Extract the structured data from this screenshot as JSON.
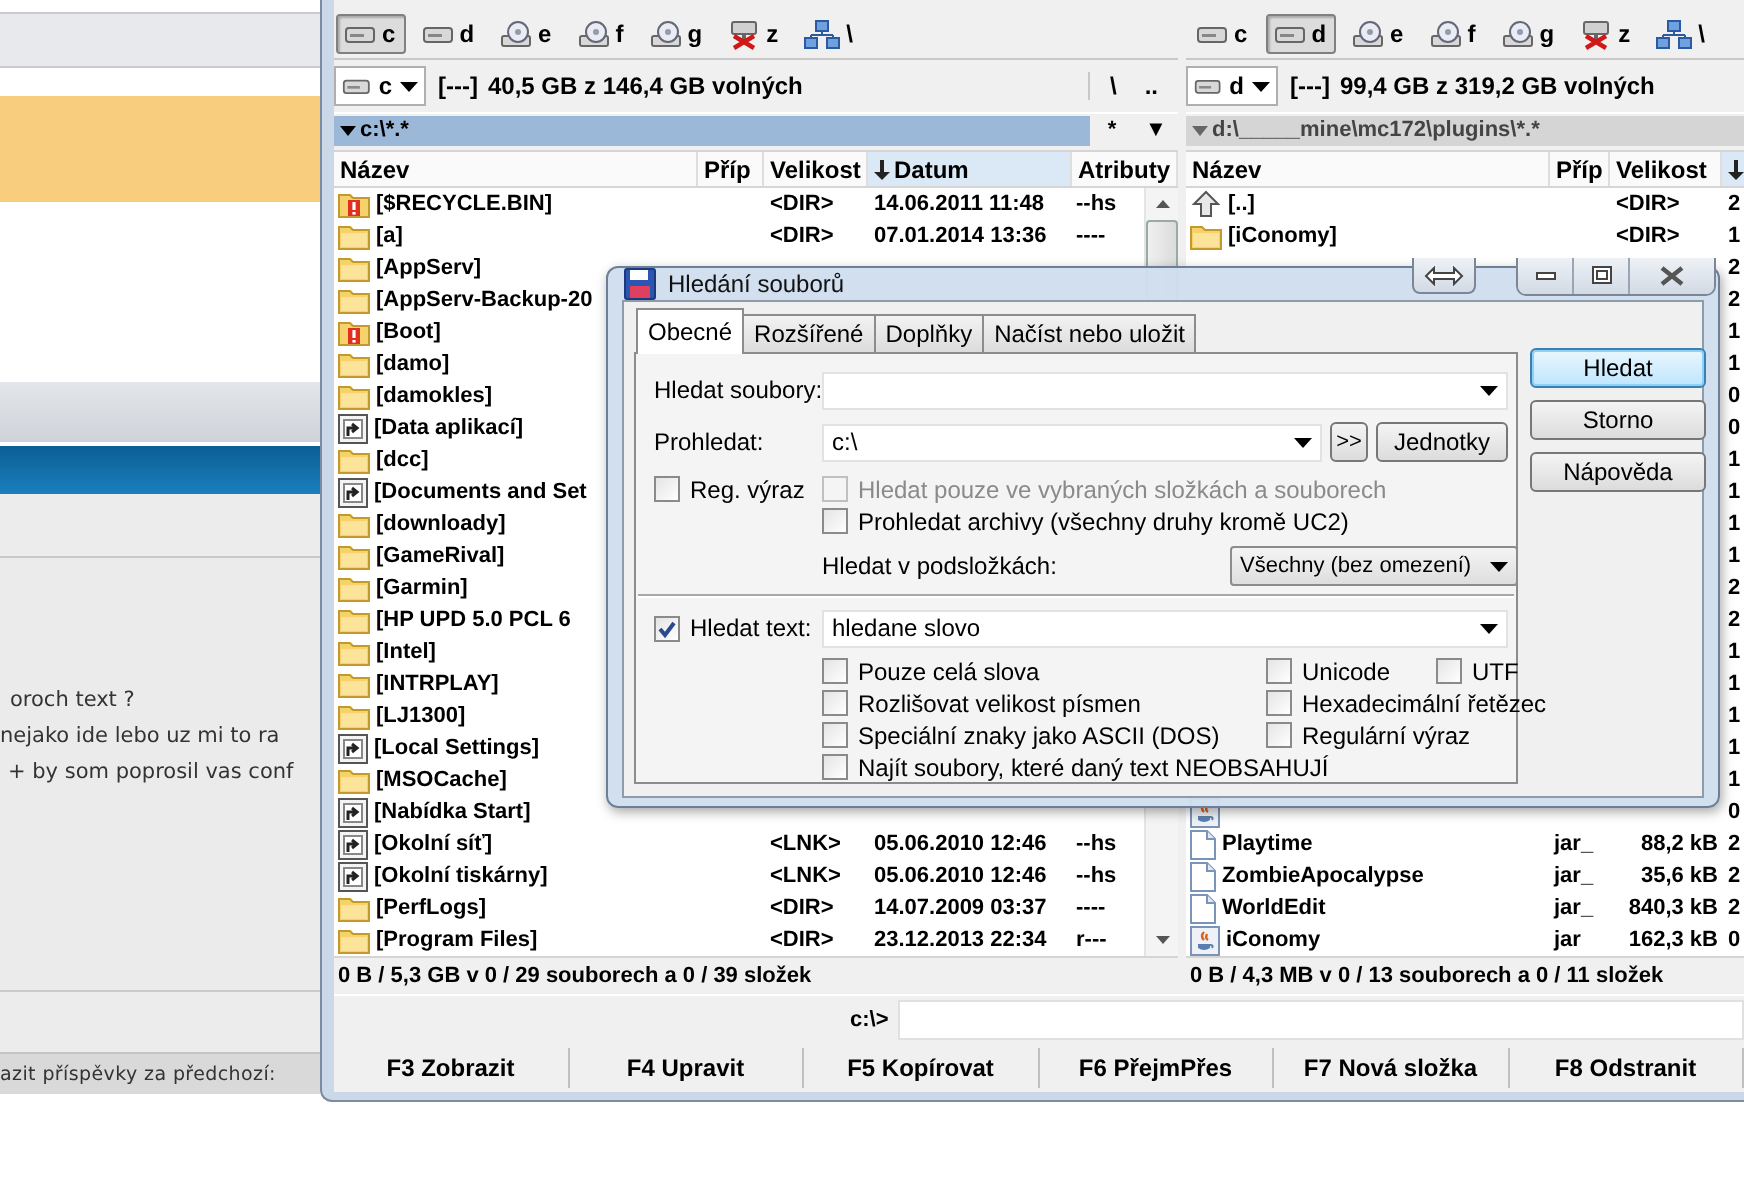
{
  "background_page": {
    "text_lines": [
      "oroch text ?",
      "nejako ide lebo uz mi to ra",
      "+ by som poprosil vas conf"
    ],
    "footer": "azit příspěvky za předchozí:"
  },
  "panels": [
    {
      "active": true,
      "drive_buttons": [
        {
          "label": "c",
          "kind": "hdd",
          "selected": true
        },
        {
          "label": "d",
          "kind": "hdd",
          "selected": false
        },
        {
          "label": "e",
          "kind": "disc",
          "selected": false
        },
        {
          "label": "f",
          "kind": "disc",
          "selected": false
        },
        {
          "label": "g",
          "kind": "disc",
          "selected": false
        },
        {
          "label": "z",
          "kind": "net-off",
          "selected": false
        },
        {
          "label": "\\",
          "kind": "network",
          "selected": false
        }
      ],
      "drive_select": "c",
      "volume_label": "[---]",
      "free_space": "40,5 GB z 146,4 GB volných",
      "nav_buttons": [
        "\\",
        ".."
      ],
      "path": "c:\\*.*",
      "path_buttons": [
        "*",
        "▼"
      ],
      "columns": [
        {
          "label": "Název",
          "sorted": false
        },
        {
          "label": "Příp",
          "sorted": false
        },
        {
          "label": "Velikost",
          "sorted": false
        },
        {
          "label": "Datum",
          "sorted": true
        },
        {
          "label": "Atributy",
          "sorted": false
        }
      ],
      "rows": [
        {
          "kind": "folder-warning",
          "name": "[$RECYCLE.BIN]",
          "size": "<DIR>",
          "date": "14.06.2011 11:48",
          "attr": "--hs"
        },
        {
          "kind": "folder",
          "name": "[a]",
          "size": "<DIR>",
          "date": "07.01.2014 13:36",
          "attr": "----"
        },
        {
          "kind": "folder",
          "name": "[AppServ]"
        },
        {
          "kind": "folder",
          "name": "[AppServ-Backup-20"
        },
        {
          "kind": "folder-warning",
          "name": "[Boot]"
        },
        {
          "kind": "folder",
          "name": "[damo]"
        },
        {
          "kind": "folder",
          "name": "[damokles]"
        },
        {
          "kind": "link",
          "name": "[Data aplikací]"
        },
        {
          "kind": "folder",
          "name": "[dcc]"
        },
        {
          "kind": "link",
          "name": "[Documents and Set"
        },
        {
          "kind": "folder",
          "name": "[downloady]"
        },
        {
          "kind": "folder",
          "name": "[GameRival]"
        },
        {
          "kind": "folder",
          "name": "[Garmin]"
        },
        {
          "kind": "folder",
          "name": "[HP UPD 5.0 PCL 6"
        },
        {
          "kind": "folder",
          "name": "[Intel]"
        },
        {
          "kind": "folder",
          "name": "[INTRPLAY]"
        },
        {
          "kind": "folder",
          "name": "[LJ1300]"
        },
        {
          "kind": "link",
          "name": "[Local Settings]"
        },
        {
          "kind": "folder",
          "name": "[MSOCache]"
        },
        {
          "kind": "link",
          "name": "[Nabídka Start]"
        },
        {
          "kind": "link",
          "name": "[Okolní síť]",
          "size": "<LNK>",
          "date": "05.06.2010 12:46",
          "attr": "--hs"
        },
        {
          "kind": "link",
          "name": "[Okolní tiskárny]",
          "size": "<LNK>",
          "date": "05.06.2010 12:46",
          "attr": "--hs"
        },
        {
          "kind": "folder",
          "name": "[PerfLogs]",
          "size": "<DIR>",
          "date": "14.07.2009 03:37",
          "attr": "----"
        },
        {
          "kind": "folder",
          "name": "[Program Files]",
          "size": "<DIR>",
          "date": "23.12.2013 22:34",
          "attr": "r---"
        }
      ],
      "status": "0 B / 5,3 GB v 0 / 29 souborech a 0 / 39 složek"
    },
    {
      "active": false,
      "drive_buttons": [
        {
          "label": "c",
          "kind": "hdd",
          "selected": false
        },
        {
          "label": "d",
          "kind": "hdd",
          "selected": true
        },
        {
          "label": "e",
          "kind": "disc",
          "selected": false
        },
        {
          "label": "f",
          "kind": "disc",
          "selected": false
        },
        {
          "label": "g",
          "kind": "disc",
          "selected": false
        },
        {
          "label": "z",
          "kind": "net-off",
          "selected": false
        },
        {
          "label": "\\",
          "kind": "network",
          "selected": false
        }
      ],
      "drive_select": "d",
      "volume_label": "[---]",
      "free_space": "99,4 GB z 319,2 GB volných",
      "path": "d:\\_____mine\\mc172\\plugins\\*.*",
      "columns": [
        {
          "label": "Název",
          "sorted": false
        },
        {
          "label": "Příp",
          "sorted": false
        },
        {
          "label": "Velikost",
          "sorted": false
        },
        {
          "sorted": true
        }
      ],
      "rows": [
        {
          "kind": "up",
          "name": "[..]",
          "size": "<DIR>",
          "date": "2"
        },
        {
          "kind": "folder",
          "name": "[iConomy]",
          "size": "<DIR>",
          "date": "1"
        },
        {
          "date": "2"
        },
        {
          "date": "2"
        },
        {
          "date": "1"
        },
        {
          "date": "1"
        },
        {
          "date": "0"
        },
        {
          "date": "0"
        },
        {
          "date": "1"
        },
        {
          "date": "1"
        },
        {
          "date": "1"
        },
        {
          "date": "1"
        },
        {
          "date": "2"
        },
        {
          "date": "2"
        },
        {
          "date": "1"
        },
        {
          "date": "1"
        },
        {
          "date": "1"
        },
        {
          "date": "1"
        },
        {
          "date": "1"
        },
        {
          "kind": "jar",
          "date": "0"
        },
        {
          "kind": "file",
          "name": "Playtime",
          "ext": "jar_",
          "size": "88,2 kB",
          "date": "2"
        },
        {
          "kind": "file",
          "name": "ZombieApocalypse",
          "ext": "jar_",
          "size": "35,6 kB",
          "date": "2"
        },
        {
          "kind": "file",
          "name": "WorldEdit",
          "ext": "jar_",
          "size": "840,3 kB",
          "date": "2"
        },
        {
          "kind": "jar",
          "name": "iConomy",
          "ext": "jar",
          "size": "162,3 kB",
          "date": "0"
        }
      ],
      "status": "0 B / 4,3 MB v 0 / 13 souborech a 0 / 11 složek"
    }
  ],
  "command_line": {
    "prompt": "c:\\>"
  },
  "function_keys": [
    "F3 Zobrazit",
    "F4 Upravit",
    "F5 Kopírovat",
    "F6 PřejmPřes",
    "F7 Nová složka",
    "F8 Odstranit"
  ],
  "dialog": {
    "title": "Hledání souborů",
    "tabs": [
      {
        "label": "Obecné",
        "selected": true
      },
      {
        "label": "Rozšířené",
        "selected": false
      },
      {
        "label": "Doplňky",
        "selected": false
      },
      {
        "label": "Načíst nebo uložit",
        "selected": false
      }
    ],
    "search_files": {
      "label": "Hledat soubory:"
    },
    "search_in": {
      "label": "Prohledat:",
      "value": "c:\\",
      "buttons": [
        ">>",
        "Jednotky"
      ]
    },
    "regex": {
      "label": "Reg. výraz",
      "checked": false,
      "disabled": false
    },
    "only_selected": {
      "label": "Hledat pouze ve vybraných složkách a souborech",
      "checked": false,
      "disabled": true
    },
    "archives": {
      "label": "Prohledat archivy (všechny druhy kromě UC2)",
      "checked": false,
      "disabled": false
    },
    "subfolders": {
      "label": "Hledat v podsložkách:",
      "value": "Všechny (bez omezení)"
    },
    "search_text": {
      "label": "Hledat text:",
      "checked": true,
      "disabled": false,
      "value": "hledane slovo"
    },
    "text_options": [
      [
        {
          "label": "Pouze celá slova",
          "checked": false,
          "disabled": false
        },
        {
          "label": "Unicode",
          "checked": false,
          "disabled": false
        },
        {
          "label": "UTF",
          "checked": false,
          "disabled": false
        }
      ],
      [
        {
          "label": "Rozlišovat velikost písmen",
          "checked": false,
          "disabled": false
        },
        {
          "label": "Hexadecimální řetězec",
          "checked": false,
          "disabled": false
        }
      ],
      [
        {
          "label": "Speciální znaky jako ASCII (DOS)",
          "checked": false,
          "disabled": false
        },
        {
          "label": "Regulární výraz",
          "checked": false,
          "disabled": false
        }
      ],
      [
        {
          "label": "Najít soubory, které daný text NEOBSAHUJÍ",
          "checked": false,
          "disabled": false
        }
      ]
    ],
    "buttons": [
      {
        "label": "Hledat",
        "default": true
      },
      {
        "label": "Storno",
        "default": false
      },
      {
        "label": "Nápověda",
        "default": false
      }
    ]
  }
}
